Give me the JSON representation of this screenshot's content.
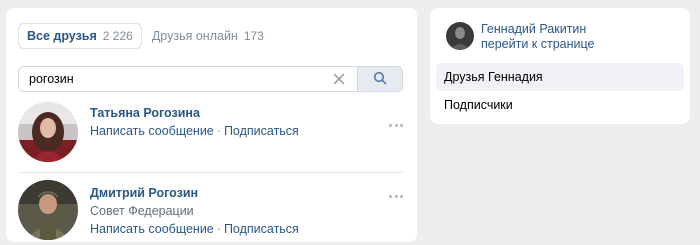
{
  "tabs": [
    {
      "label": "Все друзья",
      "count": "2 226",
      "active": true
    },
    {
      "label": "Друзья онлайн",
      "count": "173",
      "active": false
    }
  ],
  "search": {
    "value": "рогозин"
  },
  "friends": [
    {
      "name": "Татьяна Рогозина",
      "subtitle": "",
      "actions": [
        "Написать сообщение",
        "Подписаться"
      ]
    },
    {
      "name": "Дмитрий Рогозин",
      "subtitle": "Совет Федерации",
      "actions": [
        "Написать сообщение",
        "Подписаться"
      ]
    }
  ],
  "sidebar": {
    "owner_name": "Геннадий Ракитин",
    "owner_link": "перейти к странице",
    "items": [
      {
        "label": "Друзья Геннадия",
        "active": true
      },
      {
        "label": "Подписчики",
        "active": false
      }
    ]
  },
  "colors": {
    "link": "#2a5885",
    "background": "#edeef0",
    "muted": "#818c99"
  },
  "icons": {
    "clear": "close-icon",
    "search": "search-icon",
    "more": "more-horizontal-icon"
  }
}
